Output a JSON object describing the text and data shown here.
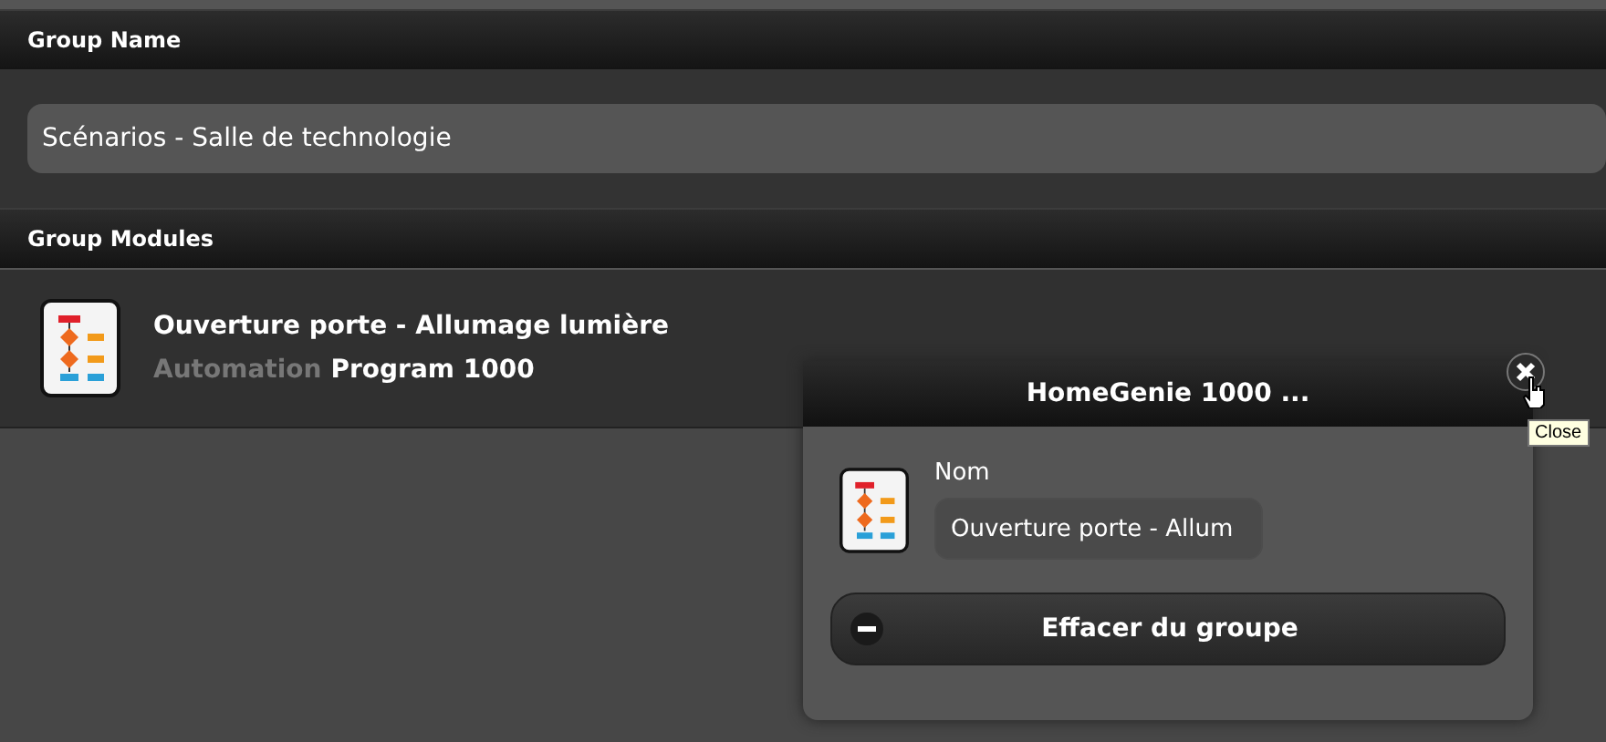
{
  "sections": [
    {
      "title": "Group Name"
    },
    {
      "title": "Group Modules"
    }
  ],
  "group_name": {
    "value": "Scénarios - Salle de technologie"
  },
  "modules": [
    {
      "name": "Ouverture porte - Allumage lumière",
      "type": "Automation",
      "address": "Program 1000"
    }
  ],
  "popup": {
    "title": "HomeGenie 1000 ...",
    "field_label": "Nom",
    "field_value": "Ouverture porte - Allum",
    "button": "Effacer du groupe",
    "close_tooltip": "Close"
  }
}
